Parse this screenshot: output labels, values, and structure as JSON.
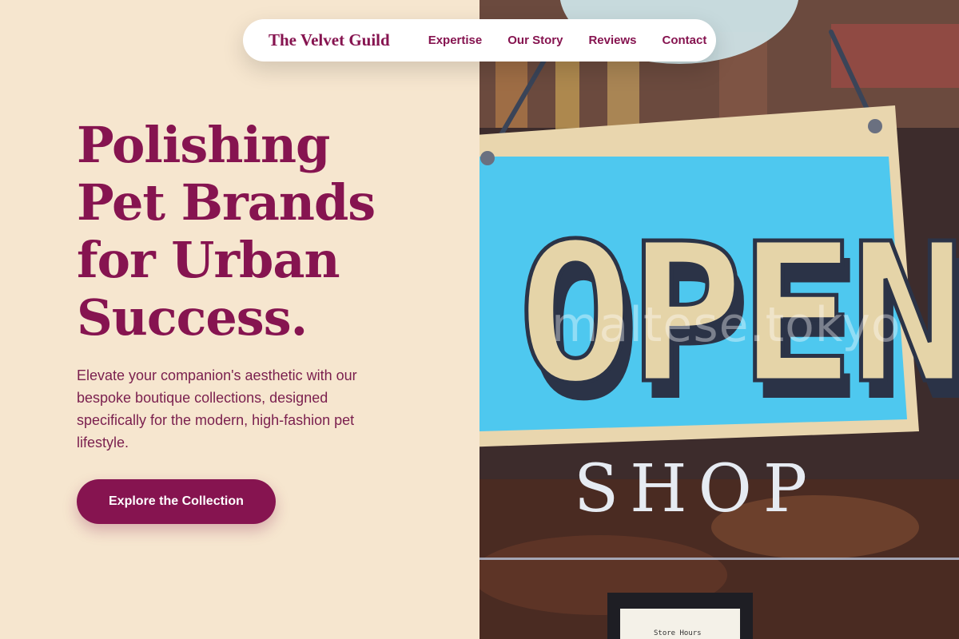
{
  "nav": {
    "brand": "The Velvet Guild",
    "links": [
      "Expertise",
      "Our Story",
      "Reviews",
      "Contact"
    ]
  },
  "hero": {
    "title_lines": [
      "Polishing",
      "Pet Brands",
      "for Urban",
      "Success."
    ],
    "subtitle": "Elevate your companion's aesthetic with our bespoke boutique collections, designed specifically for the modern, high-fashion pet lifestyle.",
    "cta_label": "Explore the Collection"
  },
  "photo": {
    "sign_text": "OPEN",
    "window_text": "SHOP",
    "watermark": "maltese.tokyo",
    "store_hours_text": "Store Hours"
  },
  "colors": {
    "brand": "#861450",
    "background": "#f6e6cf",
    "sign_blue": "#4ec8ef",
    "sign_board": "#e9d6ae",
    "sign_letters": "#e5d4a8",
    "sign_dark": "#2b3347"
  }
}
